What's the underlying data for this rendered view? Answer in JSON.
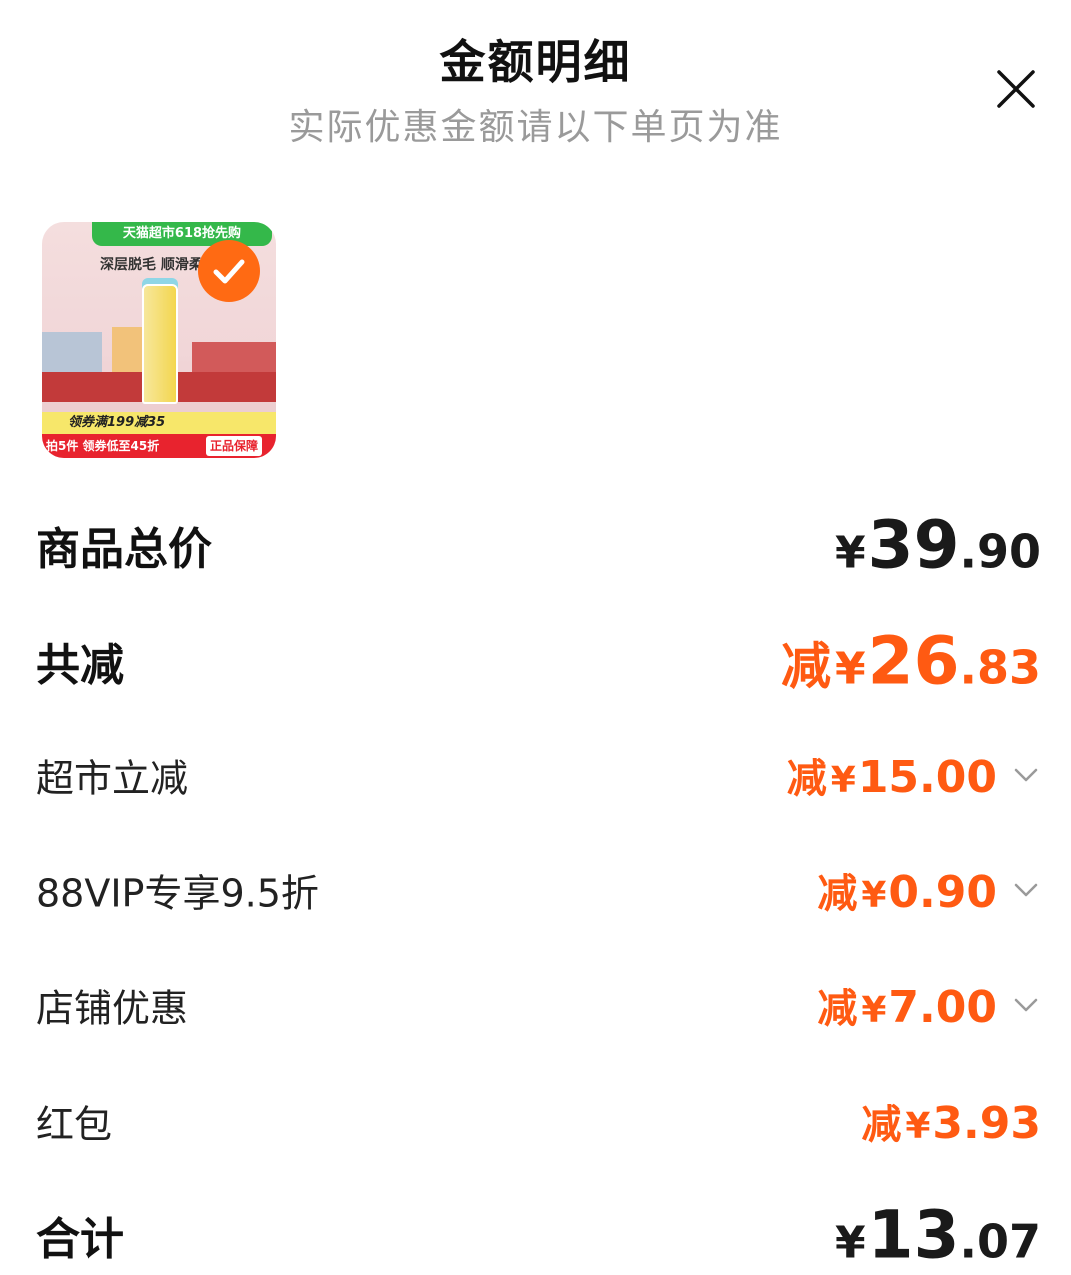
{
  "header": {
    "title": "金额明细",
    "subtitle": "实际优惠金额请以下单页为准"
  },
  "product": {
    "banner": "天猫超市618抢先购",
    "tagline": "深层脱毛 顺滑柔",
    "coupon": "领券满199减35",
    "footer": "拍5件 领券低至45折",
    "guarantee": "正品保障",
    "selected": true,
    "accent": "#ff6a13"
  },
  "rows": {
    "total": {
      "label": "商品总价",
      "yen": "¥",
      "int": "39",
      "dec": ".90"
    },
    "discount_total": {
      "label": "共减",
      "minus": "减",
      "yen": "¥",
      "int": "26",
      "dec": ".83"
    },
    "supermarket": {
      "label": "超市立减",
      "minus": "减",
      "yen": "¥",
      "int": "15",
      "dec": ".00"
    },
    "vip": {
      "label": "88VIP专享9.5折",
      "minus": "减",
      "yen": "¥",
      "int": "0",
      "dec": ".90"
    },
    "store": {
      "label": "店铺优惠",
      "minus": "减",
      "yen": "¥",
      "int": "7",
      "dec": ".00"
    },
    "red_packet": {
      "label": "红包",
      "minus": "减",
      "yen": "¥",
      "int": "3",
      "dec": ".93"
    },
    "sum": {
      "label": "合计",
      "yen": "¥",
      "int": "13",
      "dec": ".07"
    }
  },
  "colors": {
    "discount": "#ff5a12",
    "text": "#1a1a1a",
    "subtitle": "#9a9a9a"
  }
}
